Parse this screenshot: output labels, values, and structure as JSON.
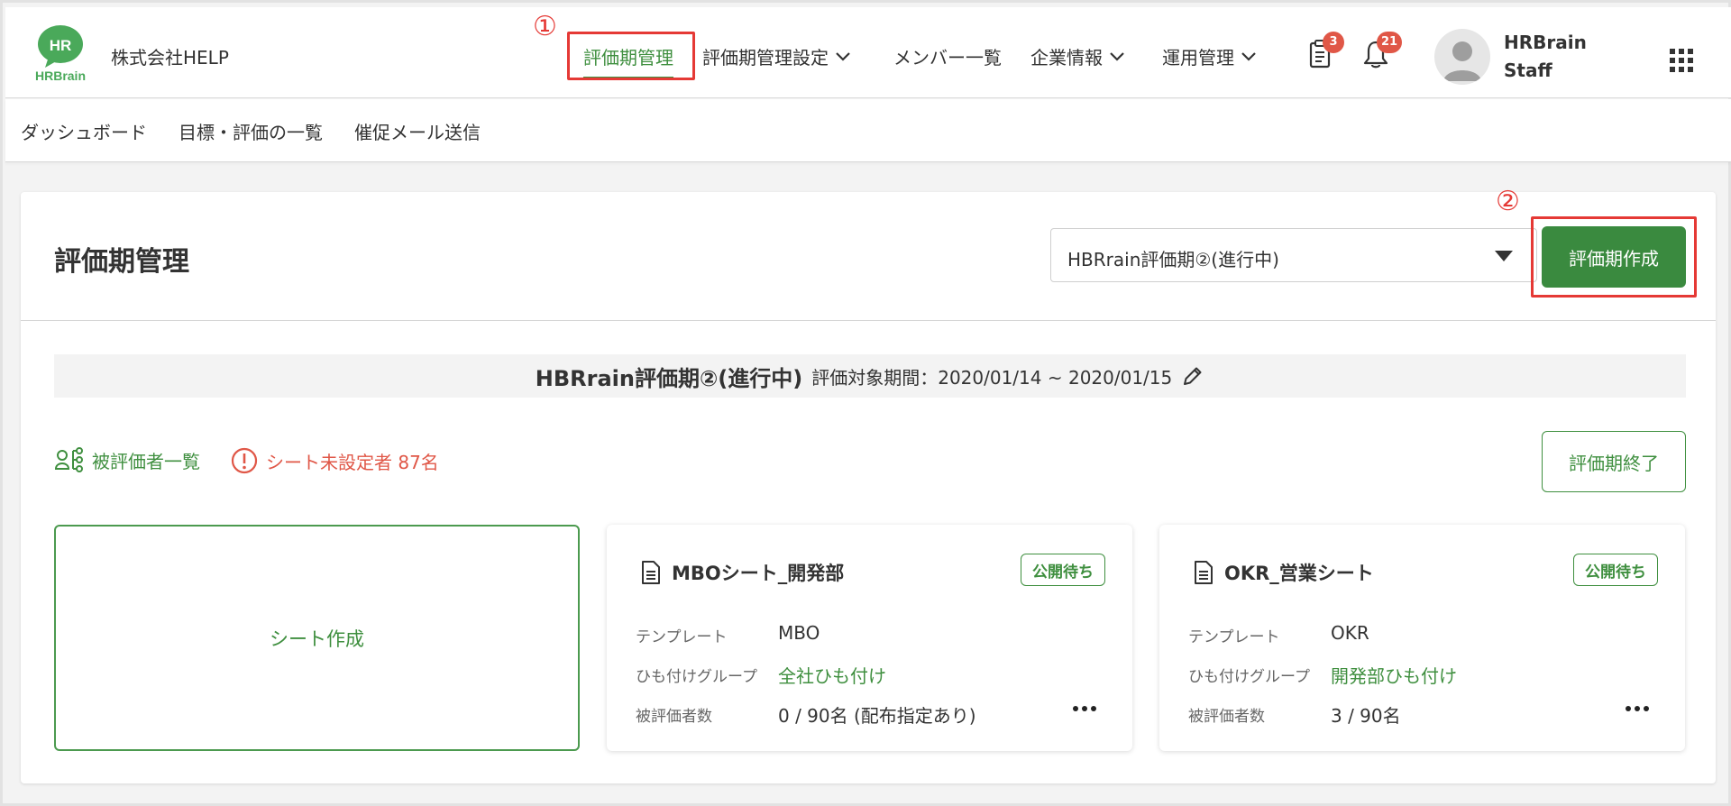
{
  "header": {
    "logo_text_top": "HR",
    "logo_text_bottom": "HRBrain",
    "company": "株式会社HELP",
    "nav": [
      {
        "label": "評価期管理",
        "active": true
      },
      {
        "label": "評価期管理設定",
        "dropdown": true
      },
      {
        "label": "メンバー一覧"
      },
      {
        "label": "企業情報",
        "dropdown": true
      },
      {
        "label": "運用管理",
        "dropdown": true
      }
    ],
    "tasks_badge": "3",
    "notifications_badge": "21",
    "user_line1": "HRBrain",
    "user_line2": "Staff",
    "step1": "①",
    "step2": "②"
  },
  "subnav": {
    "items": [
      "ダッシュボード",
      "目標・評価の一覧",
      "催促メール送信"
    ]
  },
  "main": {
    "title": "評価期管理",
    "period_select_value": "HBRrain評価期②(進行中)",
    "create_period_label": "評価期作成",
    "banner_name": "HBRrain評価期②(進行中)",
    "banner_range": "評価対象期間：2020/01/14 ~ 2020/01/15",
    "evaluatee_list_label": "被評価者一覧",
    "unassigned_label": "シート未設定者 87名",
    "end_period_label": "評価期終了",
    "create_sheet_label": "シート作成",
    "sheets": [
      {
        "title": "MBOシート_開発部",
        "status": "公開待ち",
        "template_label": "テンプレート",
        "template": "MBO",
        "group_label": "ひも付けグループ",
        "group": "全社ひも付け",
        "count_label": "被評価者数",
        "count": "0 / 90名 (配布指定あり)"
      },
      {
        "title": "OKR_営業シート",
        "status": "公開待ち",
        "template_label": "テンプレート",
        "template": "OKR",
        "group_label": "ひも付けグループ",
        "group": "開発部ひも付け",
        "count_label": "被評価者数",
        "count": "3 / 90名"
      }
    ]
  },
  "colors": {
    "brand_green": "#3a8a3f",
    "accent_red": "#e05747",
    "highlight_red": "#e53935"
  }
}
